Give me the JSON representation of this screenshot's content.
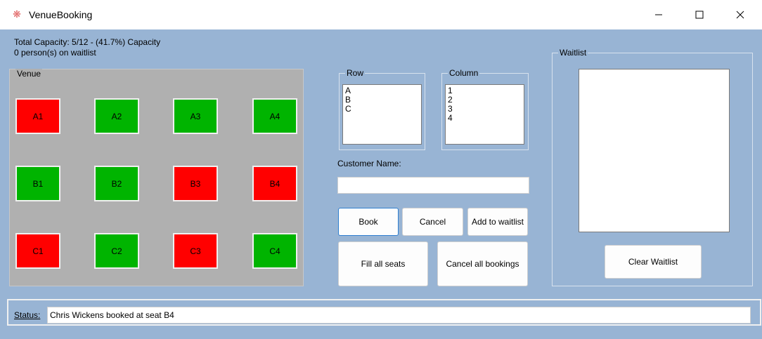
{
  "window": {
    "title": "VenueBooking",
    "app_icon": "asterisk-icon",
    "controls": [
      "minimize-icon",
      "maximize-icon",
      "close-icon"
    ]
  },
  "summary": {
    "capacity_line": "Total Capacity: 5/12  - (41.7%) Capacity",
    "waitlist_line": "0 person(s) on waitlist"
  },
  "venue": {
    "label": "Venue",
    "colors": {
      "booked": "#ff0000",
      "free": "#00b400"
    },
    "seats": [
      {
        "label": "A1",
        "status": "booked"
      },
      {
        "label": "A2",
        "status": "free"
      },
      {
        "label": "A3",
        "status": "free"
      },
      {
        "label": "A4",
        "status": "free"
      },
      {
        "label": "B1",
        "status": "free"
      },
      {
        "label": "B2",
        "status": "free"
      },
      {
        "label": "B3",
        "status": "booked"
      },
      {
        "label": "B4",
        "status": "booked"
      },
      {
        "label": "C1",
        "status": "booked"
      },
      {
        "label": "C2",
        "status": "free"
      },
      {
        "label": "C3",
        "status": "booked"
      },
      {
        "label": "C4",
        "status": "free"
      }
    ]
  },
  "row_selector": {
    "label": "Row",
    "options": [
      "A",
      "B",
      "C"
    ]
  },
  "column_selector": {
    "label": "Column",
    "options": [
      "1",
      "2",
      "3",
      "4"
    ]
  },
  "customer": {
    "label": "Customer Name:",
    "value": ""
  },
  "buttons": {
    "book": "Book",
    "cancel": "Cancel",
    "add_to_waitlist": "Add to waitlist",
    "fill_all": "Fill all seats",
    "cancel_all": "Cancel all bookings",
    "clear_waitlist": "Clear Waitlist"
  },
  "waitlist": {
    "label": "Waitlist",
    "items": []
  },
  "status": {
    "label": "Status:",
    "text": "Chris Wickens booked at seat B4"
  }
}
